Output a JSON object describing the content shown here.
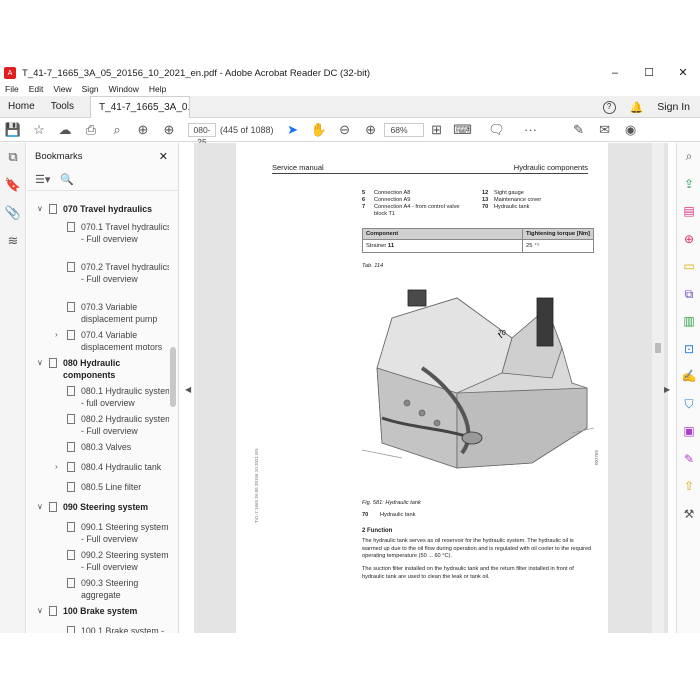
{
  "window": {
    "title": "T_41-7_1665_3A_05_20156_10_2021_en.pdf - Adobe Acrobat Reader DC (32-bit)",
    "min": "–",
    "max": "☐",
    "close": "✕"
  },
  "menu": [
    "File",
    "Edit",
    "View",
    "Sign",
    "Window",
    "Help"
  ],
  "tabs": {
    "home": "Home",
    "tools": "Tools",
    "doc": "T_41-7_1665_3A_0...",
    "doc_close": "×",
    "sign_in": "Sign In"
  },
  "toolbar": {
    "page_input": "080-25",
    "page_count": "(445 of 1088)",
    "zoom": "68%",
    "more": "···"
  },
  "bookmarks": {
    "title": "Bookmarks",
    "close": "✕",
    "items": [
      {
        "label": "070 Travel hydraulics",
        "chev": "∨"
      },
      {
        "label": "070.1 Travel hydraulics - Full overview",
        "chev": ""
      },
      {
        "label": "070.2 Travel hydraulics - Full overview",
        "chev": ""
      },
      {
        "label": "070.3 Variable displacement pump",
        "chev": ""
      },
      {
        "label": "070.4 Variable displacement motors",
        "chev": "›"
      },
      {
        "label": "080 Hydraulic components",
        "chev": "∨"
      },
      {
        "label": "080.1 Hydraulic system - full overview",
        "chev": ""
      },
      {
        "label": "080.2 Hydraulic system - Full overview",
        "chev": ""
      },
      {
        "label": "080.3 Valves",
        "chev": ""
      },
      {
        "label": "080.4 Hydraulic tank",
        "chev": "›"
      },
      {
        "label": "080.5 Line filter",
        "chev": ""
      },
      {
        "label": "090 Steering system",
        "chev": "∨"
      },
      {
        "label": "090.1 Steering system - Full overview",
        "chev": ""
      },
      {
        "label": "090.2 Steering system - Full overview",
        "chev": ""
      },
      {
        "label": "090.3 Steering aggregate",
        "chev": ""
      },
      {
        "label": "100 Brake system",
        "chev": "∨"
      },
      {
        "label": "100.1 Brake system -",
        "chev": ""
      }
    ]
  },
  "page": {
    "header_left": "Service manual",
    "header_right": "Hydraulic components",
    "legend_left": [
      {
        "n": "5",
        "t": "Connection A8"
      },
      {
        "n": "6",
        "t": "Connection A9"
      },
      {
        "n": "7",
        "t": "Connection A4 - from control valve block T1"
      }
    ],
    "legend_right": [
      {
        "n": "12",
        "t": "Sight gauge"
      },
      {
        "n": "13",
        "t": "Maintenance cover"
      },
      {
        "n": "70",
        "t": "Hydraulic tank"
      }
    ],
    "table": {
      "h1": "Component",
      "h2": "Tightening torque [Nm]",
      "c1_text": "Strainer ",
      "c1_bold": "11",
      "c2": "25 ⁺⁵"
    },
    "table_caption": "Tab. 114",
    "figure_label": "70",
    "figure_id": "007765",
    "figure_caption": "Fig. 581: Hydraulic tank",
    "figure_legend_n": "70",
    "figure_legend_t": "Hydraulic tank",
    "section": "2 Function",
    "para1": "The hydraulic tank serves as oil reservoir for the hydraulic system. The hydraulic oil is warmed up due to the oil flow during operation and is regulated with oil cooler to the required operating temperature (50 ... 60 °C).",
    "para2": "The suction filter installed on the hydraulic tank and the return filter installed in front of hydraulic tank are used to clean the leak or tank oil.",
    "side_id": "T41-7 1665 3A 05 20156 10 2021 EN"
  }
}
